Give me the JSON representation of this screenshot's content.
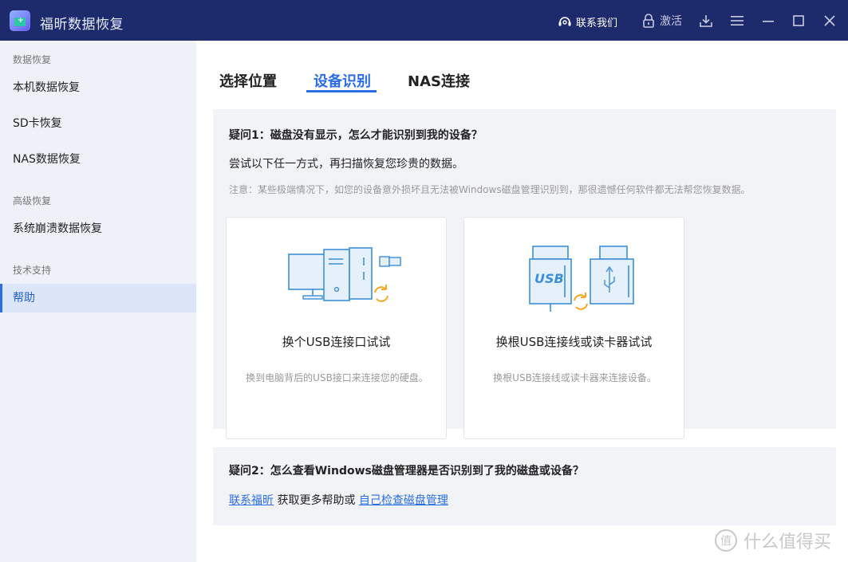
{
  "app": {
    "title": "福昕数据恢复"
  },
  "titlebar": {
    "contact_label": "联系我们",
    "activate_label": "激活",
    "icons": [
      "headset-icon",
      "lock-icon",
      "download-icon",
      "menu-icon",
      "minimize-icon",
      "maximize-icon",
      "close-icon"
    ]
  },
  "sidebar": {
    "sections": [
      {
        "label": "数据恢复",
        "items": [
          "本机数据恢复",
          "SD卡恢复",
          "NAS数据恢复"
        ]
      },
      {
        "label": "高级恢复",
        "items": [
          "系统崩溃数据恢复"
        ]
      },
      {
        "label": "技术支持",
        "items": [
          "帮助"
        ]
      }
    ],
    "active_item": "帮助"
  },
  "tabs": [
    {
      "label": "选择位置",
      "active": false
    },
    {
      "label": "设备识别",
      "active": true
    },
    {
      "label": "NAS连接",
      "active": false
    }
  ],
  "faq1": {
    "question": "疑问1：磁盘没有显示，怎么才能识别到我的设备？",
    "instruction": "尝试以下任一方式，再扫描恢复您珍贵的数据。",
    "note": "注意：某些极端情况下，如您的设备意外损坏且无法被Windows磁盘管理识别到，那很遗憾任何软件都无法帮您恢复数据。",
    "cards": [
      {
        "title": "换个USB连接口试试",
        "desc": "换到电脑背后的USB接口来连接您的硬盘。",
        "icon": "computer-usb-icon"
      },
      {
        "title": "换根USB连接线或读卡器试试",
        "desc": "换根USB连接线或读卡器来连接设备。",
        "icon": "usb-drive-icon",
        "usb_text": "USB"
      }
    ]
  },
  "faq2": {
    "question": "疑问2：怎么查看Windows磁盘管理器是否识别到了我的磁盘或设备？",
    "link1": "联系福昕",
    "middle_text": " 获取更多帮助或 ",
    "link2": "自己检查磁盘管理"
  },
  "watermark": {
    "text": "什么值得买",
    "badge": "值"
  },
  "colors": {
    "titlebar": "#1d2a6b",
    "accent": "#2b6de3",
    "sidebar": "#eef1f8",
    "panel": "#f1f3f7",
    "illustration": "#3d8fd8",
    "refresh": "#f5a623"
  }
}
